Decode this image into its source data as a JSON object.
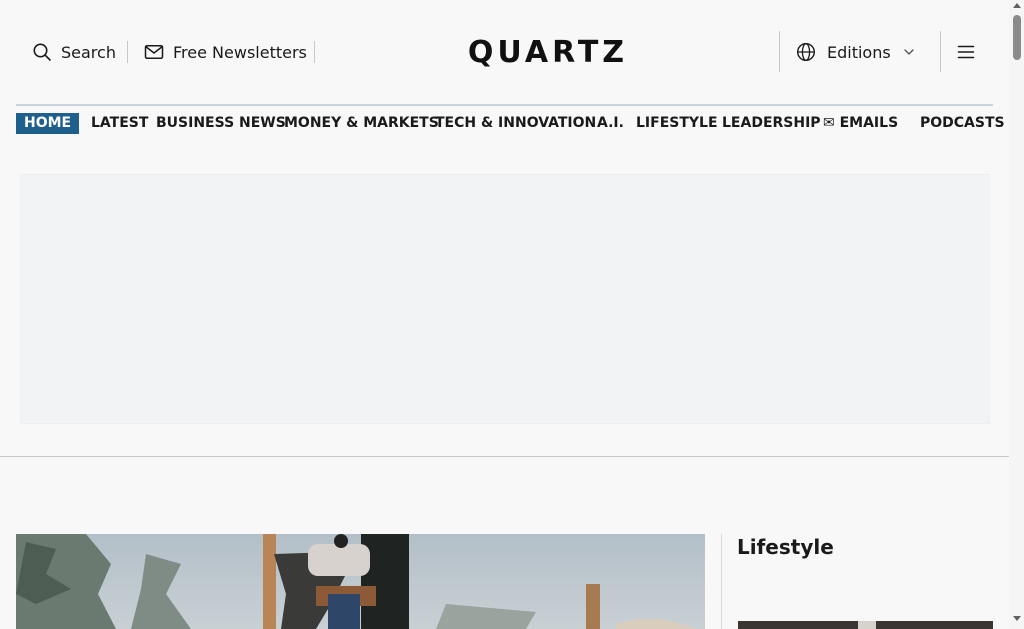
{
  "header": {
    "search_label": "Search",
    "newsletter_label": "Free Newsletters",
    "logo_text": "QUARTZ",
    "editions_label": "Editions",
    "icons": {
      "search": "search-icon",
      "newsletter": "mail-icon",
      "editions": "globe-icon",
      "editions_dropdown": "chevron-down-icon",
      "menu": "hamburger-menu-icon"
    }
  },
  "nav": {
    "items": [
      {
        "label": "HOME",
        "active": true
      },
      {
        "label": "LATEST"
      },
      {
        "label": "BUSINESS NEWS"
      },
      {
        "label": "MONEY & MARKETS"
      },
      {
        "label": "TECH & INNOVATION"
      },
      {
        "label": "A.I."
      },
      {
        "label": "LIFESTYLE"
      },
      {
        "label": "LEADERSHIP"
      },
      {
        "label": "✉ EMAILS"
      },
      {
        "label": "PODCASTS"
      }
    ]
  },
  "content": {
    "section_title": "Lifestyle"
  },
  "colors": {
    "accent": "#1f5f8b",
    "background": "#f8f8f8",
    "ad_placeholder": "#f2f3f5",
    "text": "#1a1a1a"
  }
}
